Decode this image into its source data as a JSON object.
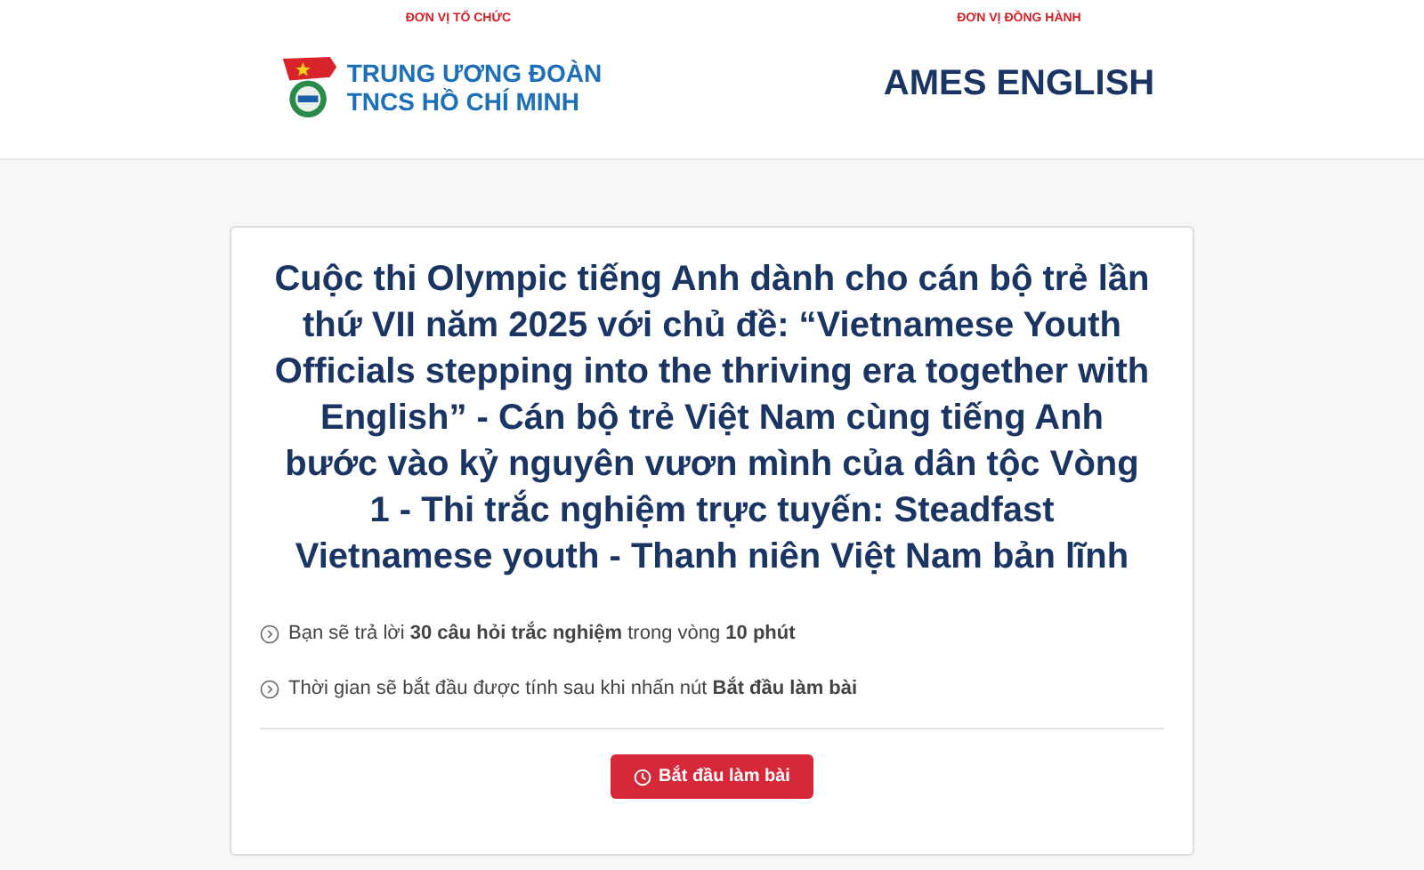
{
  "header": {
    "organizer": {
      "caption": "ĐƠN VỊ TỔ CHỨC",
      "name_lines": [
        "TRUNG ƯƠNG ĐOÀN",
        "TNCS HỒ CHÍ MINH"
      ]
    },
    "partner": {
      "caption": "ĐƠN VỊ ĐỒNG HÀNH",
      "name": "AMES ENGLISH"
    }
  },
  "card": {
    "title": "Cuộc thi Olympic tiếng Anh dành cho cán bộ trẻ lần thứ VII năm 2025 với chủ đề: “Vietnamese Youth Officials stepping into the thriving era together with English” - Cán bộ trẻ Việt Nam cùng tiếng Anh bước vào kỷ nguyên vươn mình của dân tộc Vòng 1 - Thi trắc nghiệm trực tuyến: Steadfast Vietnamese youth - Thanh niên Việt Nam bản lĩnh",
    "notes": [
      "Bạn sẽ trả lời **30 câu hỏi trắc nghiệm** trong vòng **10 phút**",
      "Thời gian sẽ bắt đầu được tính sau khi nhấn nút **Bắt đầu làm bài**"
    ],
    "start_button": "Bắt đầu làm bài"
  }
}
